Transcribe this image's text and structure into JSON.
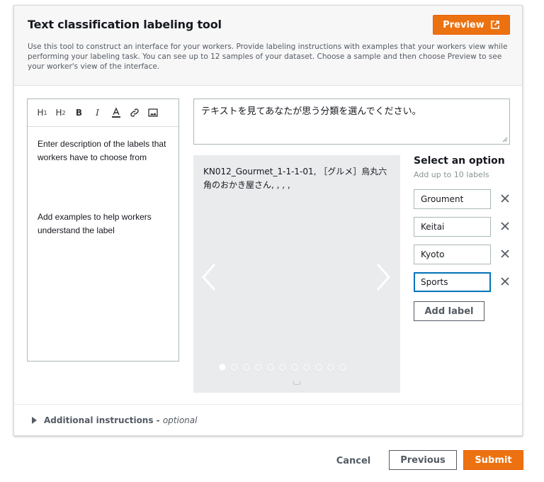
{
  "header": {
    "title": "Text classification labeling tool",
    "description": "Use this tool to construct an interface for your workers. Provide labeling instructions with examples that your workers view while performing your labeling task. You can see up to 12 samples of your dataset. Choose a sample and then choose Preview to see your worker's view of the interface.",
    "preview_label": "Preview"
  },
  "editor": {
    "toolbar": [
      {
        "name": "heading-1-icon",
        "glyph": "H",
        "sub": "1"
      },
      {
        "name": "heading-2-icon",
        "glyph": "H",
        "sub": "2"
      },
      {
        "name": "bold-icon",
        "glyph": "B"
      },
      {
        "name": "italic-icon",
        "glyph": "I"
      },
      {
        "name": "font-color-icon",
        "glyph": "A"
      },
      {
        "name": "link-icon",
        "glyph": ""
      },
      {
        "name": "image-icon",
        "glyph": ""
      }
    ],
    "paragraph_1": "Enter description of the labels that workers have to choose from",
    "paragraph_2": "Add examples to help workers understand the label"
  },
  "instruction": {
    "value": "テキストを見てあなたが思う分類を選んでください。"
  },
  "sample": {
    "text": "KN012_Gourmet_1-1-1-01, ［グルメ］烏丸六角のおかき屋さん, , , ,",
    "dot_count": 11,
    "active_index": 0
  },
  "options": {
    "title": "Select an option",
    "subtitle": "Add up to 10 labels",
    "labels": [
      "Groument",
      "Keitai",
      "Kyoto",
      "Sports"
    ],
    "focused_index": 3,
    "add_label": "Add label"
  },
  "additional": {
    "label": "Additional instructions - ",
    "optional": "optional"
  },
  "footer": {
    "cancel": "Cancel",
    "previous": "Previous",
    "submit": "Submit"
  },
  "colors": {
    "accent": "#ec7211",
    "focus": "#0073bb"
  }
}
